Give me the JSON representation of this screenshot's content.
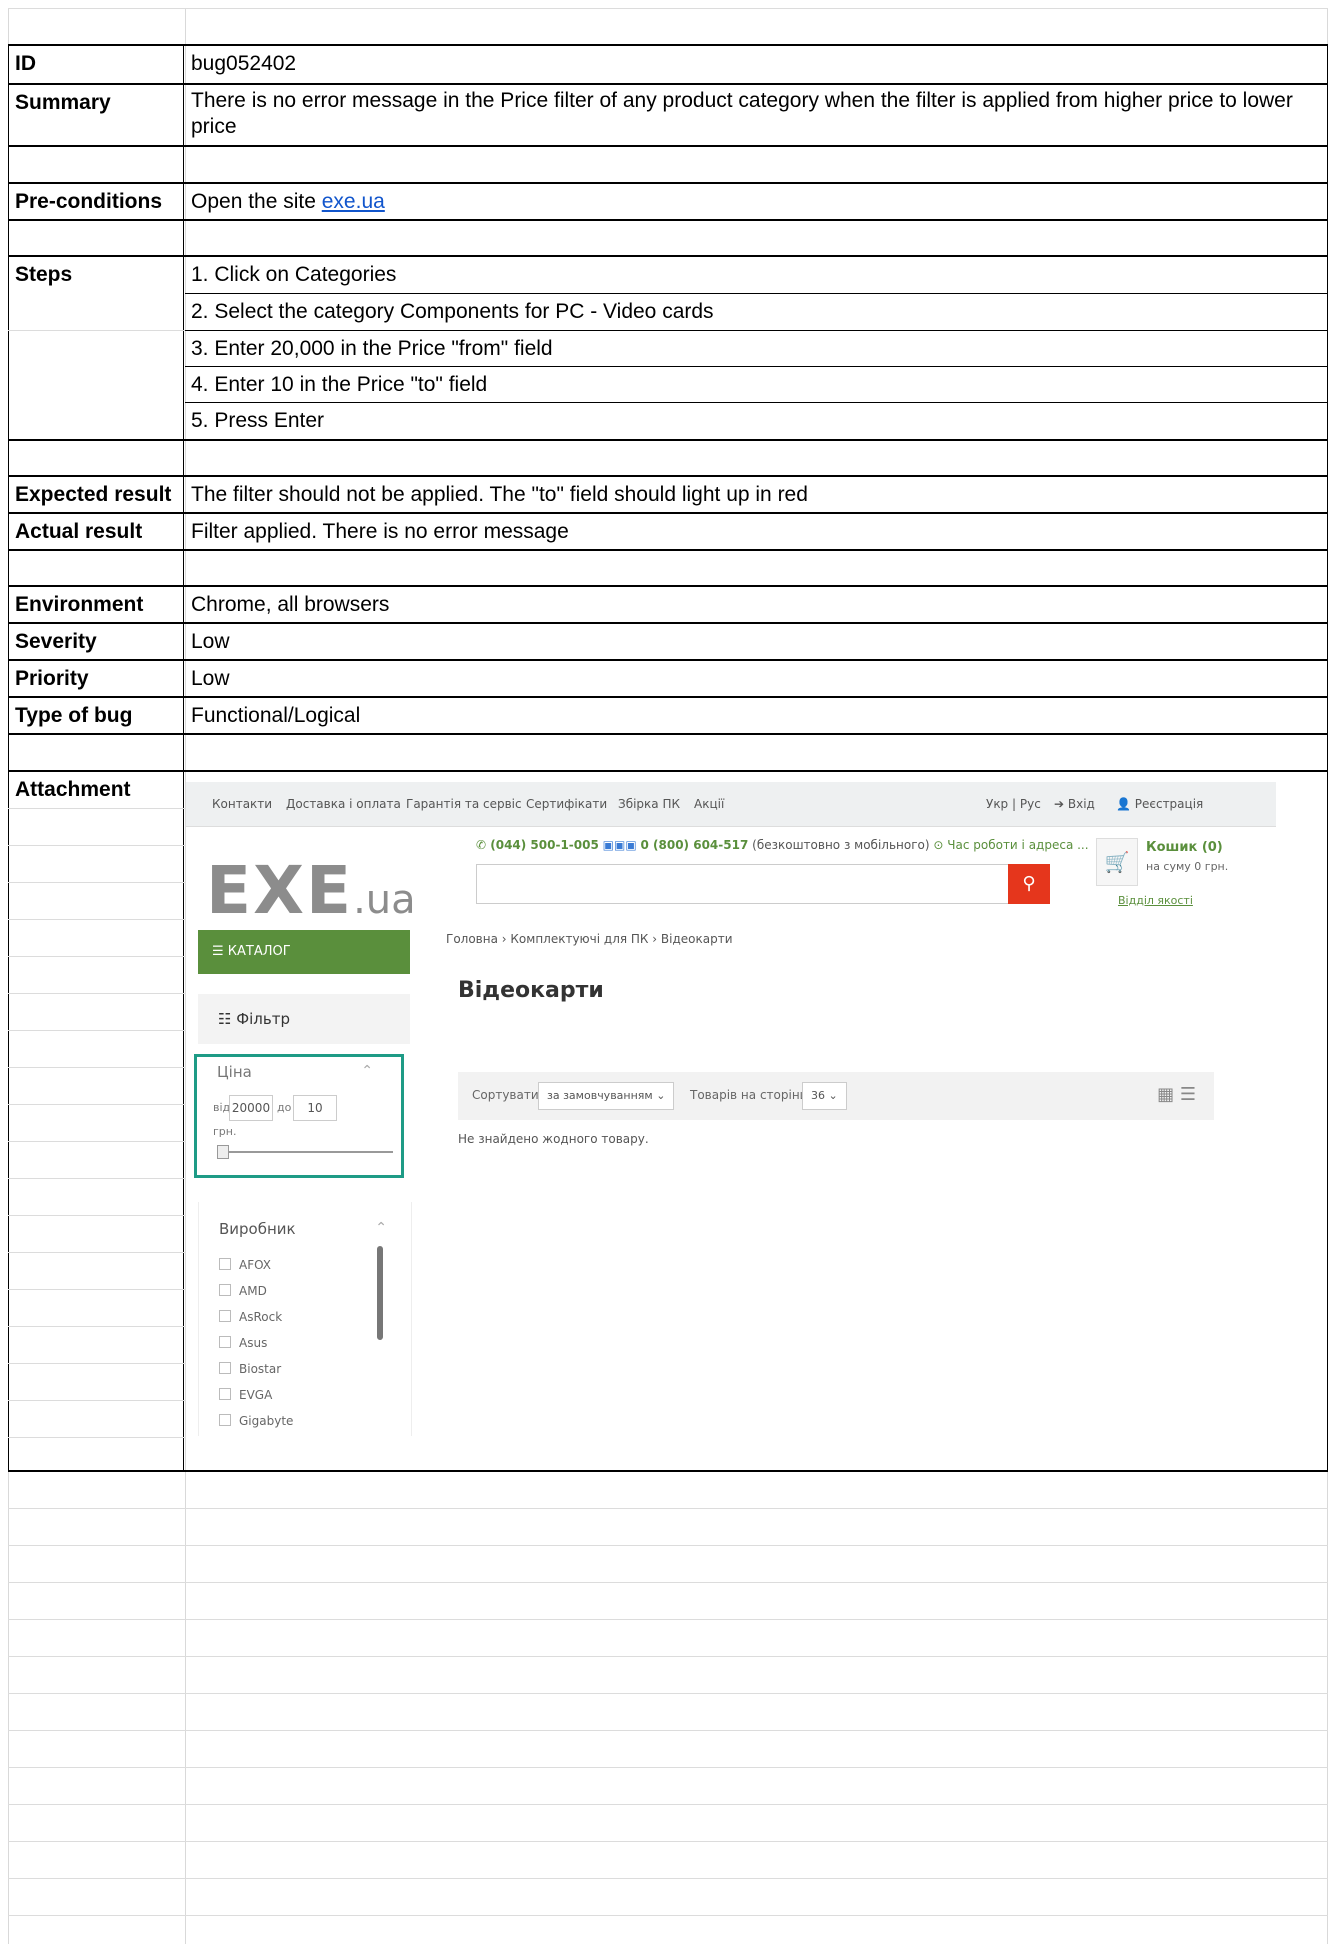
{
  "rows": {
    "id": {
      "label": "ID",
      "value": "bug052402"
    },
    "summary": {
      "label": "Summary",
      "value": "There is no error message in the Price filter of any product category when the filter is applied from higher price to lower price"
    },
    "preconditions": {
      "label": "Pre-conditions",
      "value_prefix": "Open the site ",
      "link_text": "exe.ua"
    },
    "steps": {
      "label": "Steps",
      "items": [
        "1. Click on Categories",
        "2. Select the category Components for PC - Video cards",
        "3. Enter 20,000 in the Price \"from\" field",
        "4. Enter 10 in the Price \"to\" field",
        "5. Press Enter"
      ]
    },
    "expected": {
      "label": "Expected result",
      "value": "The filter should not be applied. The \"to\" field should light up in red"
    },
    "actual": {
      "label": "Actual result",
      "value": "Filter applied. There is no error message"
    },
    "environment": {
      "label": "Environment",
      "value": "Chrome, all browsers"
    },
    "severity": {
      "label": "Severity",
      "value": "Low"
    },
    "priority": {
      "label": "Priority",
      "value": "Low"
    },
    "type": {
      "label": "Type of bug",
      "value": "Functional/Logical"
    },
    "attachment": {
      "label": "Attachment"
    }
  },
  "screenshot": {
    "nav": [
      "Контакти",
      "Доставка і оплата",
      "Гарантія та сервіс",
      "Сертифікати",
      "Збірка ПК",
      "Акції"
    ],
    "lang": "Укр | Рус",
    "login": "Вхід",
    "register": "Реєстрація",
    "logo_main": "EXE",
    "logo_suffix": ".ua",
    "phone1": "(044) 500-1-005",
    "phone2": "0 (800) 604-517",
    "phone_note": "(безкоштовно з мобільного)",
    "hours": "Час роботи і адреса ...",
    "cart_title": "Кошик (0)",
    "cart_sum": "на суму 0 грн.",
    "quality": "Відділ якості",
    "catalog": "КАТАЛОГ",
    "breadcrumb": [
      "Головна",
      "Комплектуючі для ПК",
      "Відеокарти"
    ],
    "page_title": "Відеокарти",
    "filter": "Фільтр",
    "price_label": "Ціна",
    "price_from_label": "від",
    "price_from": "20000",
    "price_to_label": "до",
    "price_to": "10",
    "currency": "грн.",
    "brand_label": "Виробник",
    "brands": [
      "AFOX",
      "AMD",
      "AsRock",
      "Asus",
      "Biostar",
      "EVGA",
      "Gigabyte"
    ],
    "sort_label": "Сортувати:",
    "sort_value": "за замовчуванням",
    "per_page_label": "Товарів на сторінці:",
    "per_page_value": "36",
    "empty_message": "Не знайдено жодного товару.",
    "highlight_color": "#1e9b86",
    "accent_color": "#5a8f3c",
    "search_button_color": "#e5361c"
  }
}
